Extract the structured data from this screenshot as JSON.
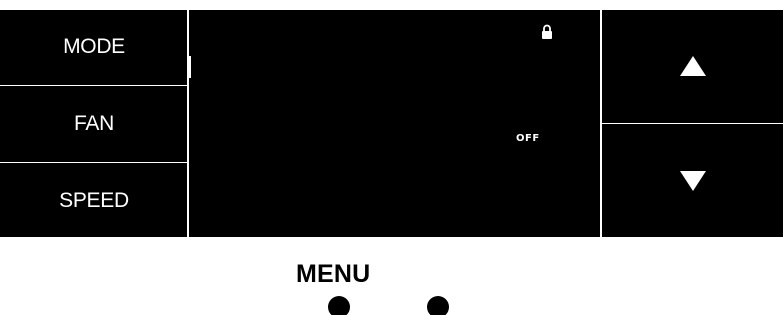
{
  "left_buttons": [
    {
      "label": "MODE"
    },
    {
      "label": "FAN"
    },
    {
      "label": "SPEED"
    }
  ],
  "screen": {
    "status_label": "OFF",
    "lock_icon": "lock-icon"
  },
  "right_buttons": {
    "up_icon": "up-arrow-icon",
    "down_icon": "down-arrow-icon"
  },
  "menu": {
    "label": "MENU"
  },
  "colors": {
    "panel": "#000000",
    "text": "#ffffff",
    "background": "#ffffff"
  }
}
